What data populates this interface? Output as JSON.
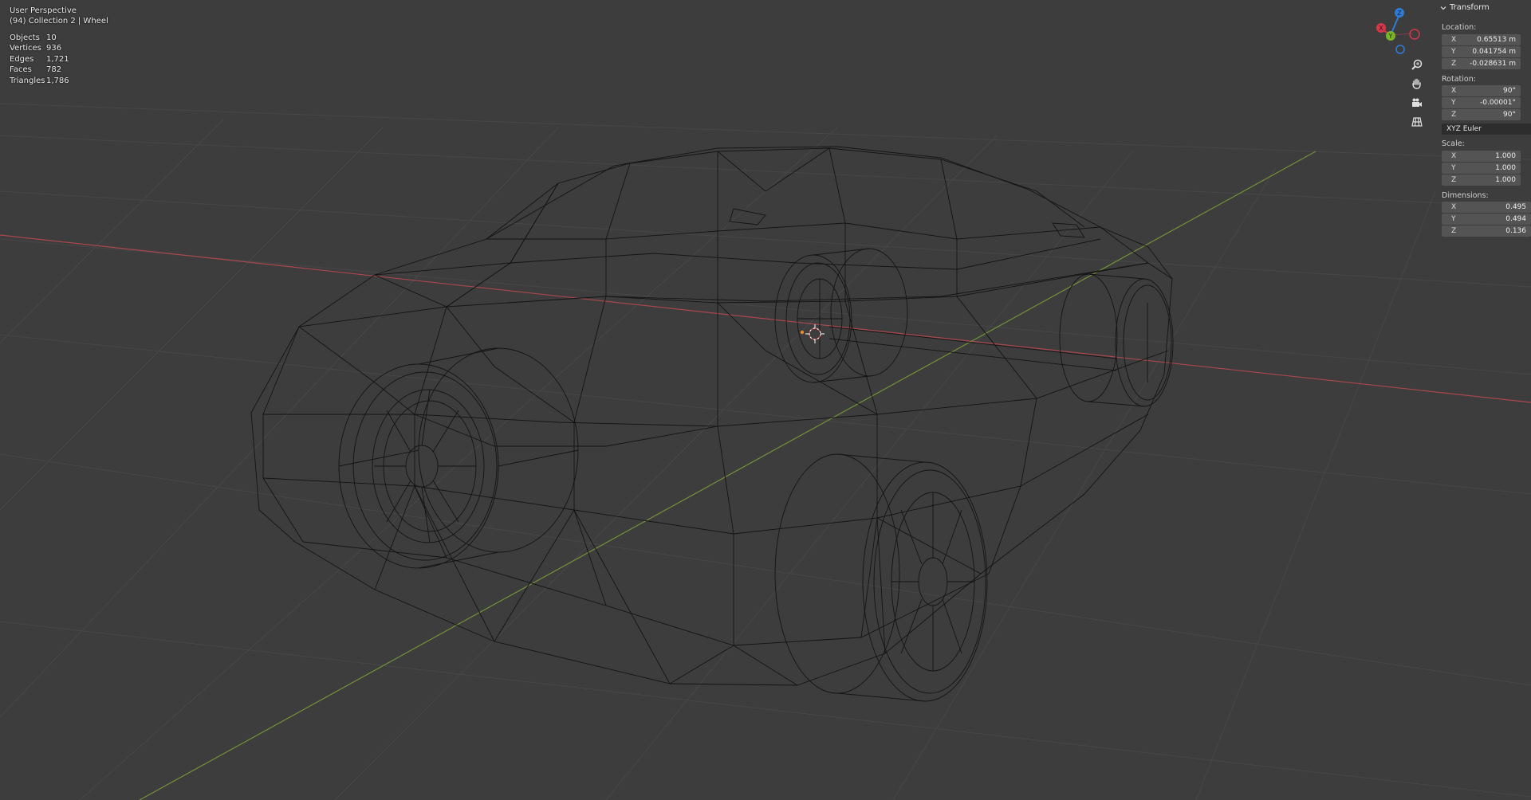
{
  "viewport": {
    "mode": "User Perspective",
    "context": "(94) Collection 2 | Wheel",
    "stats": [
      {
        "label": "Objects",
        "value": "10"
      },
      {
        "label": "Vertices",
        "value": "936"
      },
      {
        "label": "Edges",
        "value": "1,721"
      },
      {
        "label": "Faces",
        "value": "782"
      },
      {
        "label": "Triangles",
        "value": "1,786"
      }
    ]
  },
  "gizmo": {
    "axes": [
      {
        "label": "Z",
        "color": "#2f7bd8"
      },
      {
        "label": "Y",
        "color": "#7ab42a"
      },
      {
        "label": "X",
        "color": "#d2394b"
      }
    ],
    "tools": [
      "zoom-icon",
      "hand-icon",
      "camera-icon",
      "grid-icon"
    ]
  },
  "panel": {
    "header": "Transform",
    "location_label": "Location:",
    "location": [
      {
        "axis": "X",
        "value": "0.65513 m"
      },
      {
        "axis": "Y",
        "value": "0.041754 m"
      },
      {
        "axis": "Z",
        "value": "-0.028631 m"
      }
    ],
    "rotation_label": "Rotation:",
    "rotation": [
      {
        "axis": "X",
        "value": "90°"
      },
      {
        "axis": "Y",
        "value": "-0.00001°"
      },
      {
        "axis": "Z",
        "value": "90°"
      }
    ],
    "rotation_mode": "XYZ Euler",
    "scale_label": "Scale:",
    "scale": [
      {
        "axis": "X",
        "value": "1.000"
      },
      {
        "axis": "Y",
        "value": "1.000"
      },
      {
        "axis": "Z",
        "value": "1.000"
      }
    ],
    "dimensions_label": "Dimensions:",
    "dimensions": [
      {
        "axis": "X",
        "value": "0.495"
      },
      {
        "axis": "Y",
        "value": "0.494"
      },
      {
        "axis": "Z",
        "value": "0.136"
      }
    ]
  },
  "colors": {
    "background": "#3d3d3d",
    "x_axis_line": "#a8484e",
    "y_axis_line": "#73913a",
    "wire": "#141414",
    "origin": "#f08d1f"
  }
}
